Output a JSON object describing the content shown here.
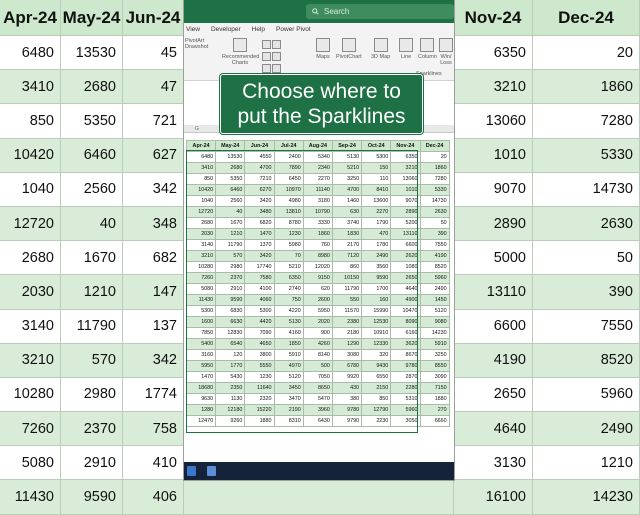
{
  "months": [
    "Apr-24",
    "May-24",
    "Jun-24",
    "Jul-24",
    "Aug-24",
    "Sep-24",
    "Oct-24",
    "Nov-24",
    "Dec-24"
  ],
  "bg_left": {
    "headers": [
      "Apr-24",
      "May-24",
      "Jun-24"
    ],
    "rows": [
      [
        "6480",
        "13530",
        "45"
      ],
      [
        "3410",
        "2680",
        "47"
      ],
      [
        "850",
        "5350",
        "721"
      ],
      [
        "10420",
        "6460",
        "627"
      ],
      [
        "1040",
        "2560",
        "342"
      ],
      [
        "12720",
        "40",
        "348"
      ],
      [
        "2680",
        "1670",
        "682"
      ],
      [
        "2030",
        "1210",
        "147"
      ],
      [
        "3140",
        "11790",
        "137"
      ],
      [
        "3210",
        "570",
        "342"
      ],
      [
        "10280",
        "2980",
        "1774"
      ],
      [
        "7260",
        "2370",
        "758"
      ],
      [
        "5080",
        "2910",
        "410"
      ],
      [
        "11430",
        "9590",
        "406"
      ]
    ]
  },
  "bg_right": {
    "headers": [
      "Nov-24",
      "Dec-24"
    ],
    "rows": [
      [
        "6350",
        "20"
      ],
      [
        "3210",
        "1860"
      ],
      [
        "13060",
        "7280"
      ],
      [
        "1010",
        "5330"
      ],
      [
        "9070",
        "14730"
      ],
      [
        "2890",
        "2630"
      ],
      [
        "5000",
        "50"
      ],
      [
        "13110",
        "390"
      ],
      [
        "6600",
        "7550"
      ],
      [
        "4190",
        "8520"
      ],
      [
        "2650",
        "5960"
      ],
      [
        "4640",
        "2490"
      ],
      [
        "3130",
        "1210"
      ],
      [
        "16100",
        "14230"
      ]
    ]
  },
  "excel": {
    "search_placeholder": "Search",
    "menu": [
      "View",
      "Developer",
      "Help",
      "Power Pivot"
    ],
    "ribbon": {
      "recommended_charts": "Recommended Charts",
      "maps": "Maps",
      "pivotchart": "PivotChart",
      "maps3d": "3D Map",
      "line": "Line",
      "column": "Column",
      "winloss": "Win/ Loss",
      "group_sparklines": "Sparklines",
      "left_labels": [
        "PivotArt",
        "Drawshot"
      ]
    },
    "namebox": "G",
    "selected_range": "G4"
  },
  "tooltip": {
    "line1": "Choose where to",
    "line2": "put the Sparklines"
  },
  "table": {
    "headers": [
      "Apr-24",
      "May-24",
      "Jun-24",
      "Jul-24",
      "Aug-24",
      "Sep-24",
      "Oct-24",
      "Nov-24",
      "Dec-24"
    ],
    "rows": [
      [
        "6480",
        "13530",
        "4550",
        "2400",
        "5340",
        "5130",
        "5300",
        "6350",
        "20"
      ],
      [
        "3410",
        "2680",
        "4700",
        "7890",
        "2340",
        "5210",
        "150",
        "3210",
        "1860"
      ],
      [
        "850",
        "5350",
        "7210",
        "6450",
        "2270",
        "3250",
        "110",
        "13060",
        "7280"
      ],
      [
        "10420",
        "6460",
        "6270",
        "10970",
        "11140",
        "4700",
        "8410",
        "1010",
        "5330"
      ],
      [
        "1040",
        "2560",
        "3420",
        "4980",
        "3180",
        "1460",
        "13600",
        "9070",
        "14730"
      ],
      [
        "12720",
        "40",
        "3480",
        "13810",
        "10790",
        "630",
        "2270",
        "2890",
        "2630"
      ],
      [
        "2680",
        "1670",
        "6820",
        "8780",
        "3330",
        "3740",
        "1790",
        "5200",
        "50"
      ],
      [
        "2030",
        "1210",
        "1470",
        "1230",
        "1860",
        "1830",
        "470",
        "13110",
        "390"
      ],
      [
        "3140",
        "11790",
        "1370",
        "5980",
        "760",
        "2170",
        "1780",
        "6600",
        "7550"
      ],
      [
        "3210",
        "570",
        "3420",
        "70",
        "8980",
        "7120",
        "2490",
        "2620",
        "4190"
      ],
      [
        "10280",
        "2980",
        "17740",
        "5210",
        "12020",
        "860",
        "3560",
        "1080",
        "8520"
      ],
      [
        "7260",
        "2370",
        "7580",
        "6350",
        "9150",
        "10150",
        "9590",
        "2650",
        "5960"
      ],
      [
        "5080",
        "2910",
        "4100",
        "2740",
        "620",
        "11790",
        "1700",
        "4640",
        "2490"
      ],
      [
        "11430",
        "9590",
        "4060",
        "750",
        "2600",
        "550",
        "160",
        "4900",
        "1450"
      ],
      [
        "5300",
        "6830",
        "5300",
        "4220",
        "5950",
        "11570",
        "15990",
        "10470",
        "5120"
      ],
      [
        "1600",
        "6630",
        "4420",
        "5130",
        "2020",
        "2380",
        "12530",
        "8090",
        "9080"
      ],
      [
        "7850",
        "12830",
        "7090",
        "4160",
        "900",
        "2180",
        "10910",
        "6160",
        "14230"
      ],
      [
        "5400",
        "6540",
        "4650",
        "1850",
        "4260",
        "1290",
        "12330",
        "3620",
        "5910"
      ],
      [
        "3160",
        "120",
        "3800",
        "5910",
        "8140",
        "3080",
        "320",
        "8670",
        "3250"
      ],
      [
        "5950",
        "1770",
        "5550",
        "4970",
        "500",
        "6780",
        "9430",
        "9780",
        "8550"
      ],
      [
        "1470",
        "5430",
        "1230",
        "5120",
        "7050",
        "9920",
        "6550",
        "2870",
        "3090"
      ],
      [
        "18680",
        "2350",
        "11640",
        "3450",
        "8650",
        "430",
        "2150",
        "2280",
        "7150"
      ],
      [
        "9630",
        "1130",
        "2320",
        "3470",
        "5470",
        "380",
        "850",
        "5310",
        "1880"
      ],
      [
        "1280",
        "12180",
        "15220",
        "2190",
        "3960",
        "9780",
        "12790",
        "5960",
        "270"
      ],
      [
        "12470",
        "9260",
        "1880",
        "8310",
        "6430",
        "9790",
        "2230",
        "3050",
        "6660"
      ]
    ]
  },
  "colors": {
    "excel_green": "#1e7145",
    "header_fill": "#cde8cd",
    "band_fill": "#d6ebd6"
  }
}
